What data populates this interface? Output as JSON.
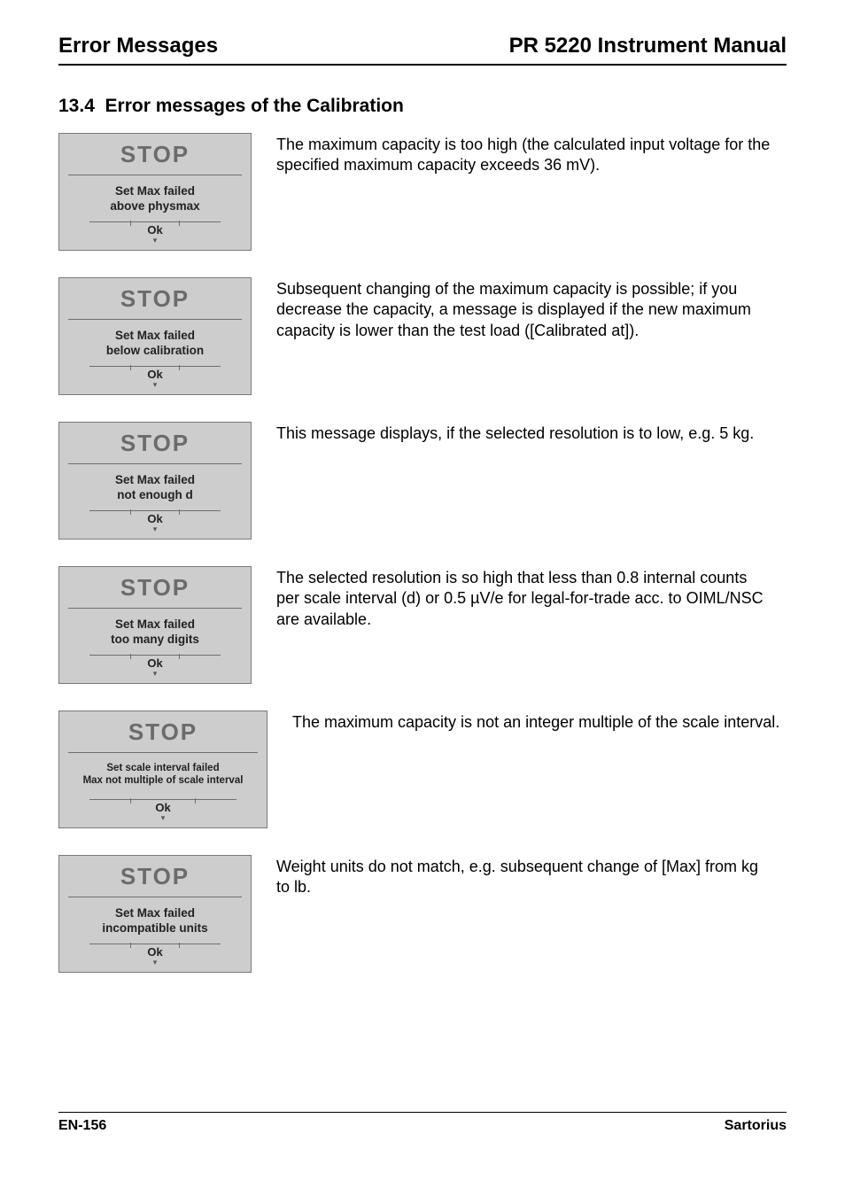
{
  "header": {
    "left": "Error Messages",
    "right": "PR 5220 Instrument Manual"
  },
  "section": {
    "number": "13.4",
    "title": "Error messages of the Calibration"
  },
  "lcd_common": {
    "stop": "STOP",
    "ok": "Ok"
  },
  "entries": [
    {
      "msg_l1": "Set Max failed",
      "msg_l2": "above physmax",
      "wide": false,
      "desc": "The maximum capacity is too high (the calculated input voltage for the specified maximum capacity exceeds 36 mV)."
    },
    {
      "msg_l1": "Set Max failed",
      "msg_l2": "below calibration",
      "wide": false,
      "desc": "Subsequent changing of the maximum capacity is possible; if you decrease the capacity, a message is displayed if the new maximum capacity is lower than the test load ([Calibrated at])."
    },
    {
      "msg_l1": "Set Max failed",
      "msg_l2": "not enough d",
      "wide": false,
      "desc": "This message displays, if the selected resolution is to low, e.g. 5 kg."
    },
    {
      "msg_l1": "Set Max failed",
      "msg_l2": "too many digits",
      "wide": false,
      "desc": "The selected resolution is so high that less than 0.8 internal counts per scale interval (d) or 0.5 µV/e for legal-for-trade acc. to OIML/NSC are available."
    },
    {
      "msg_l1": "Set scale interval failed",
      "msg_l2": "Max not multiple of scale interval",
      "wide": true,
      "desc": "The maximum capacity is not an integer multiple of the scale interval."
    },
    {
      "msg_l1": "Set Max failed",
      "msg_l2": "incompatible units",
      "wide": false,
      "desc": "Weight units do not match, e.g. subsequent change of [Max] from kg to lb."
    }
  ],
  "footer": {
    "left": "EN-156",
    "right": "Sartorius"
  }
}
